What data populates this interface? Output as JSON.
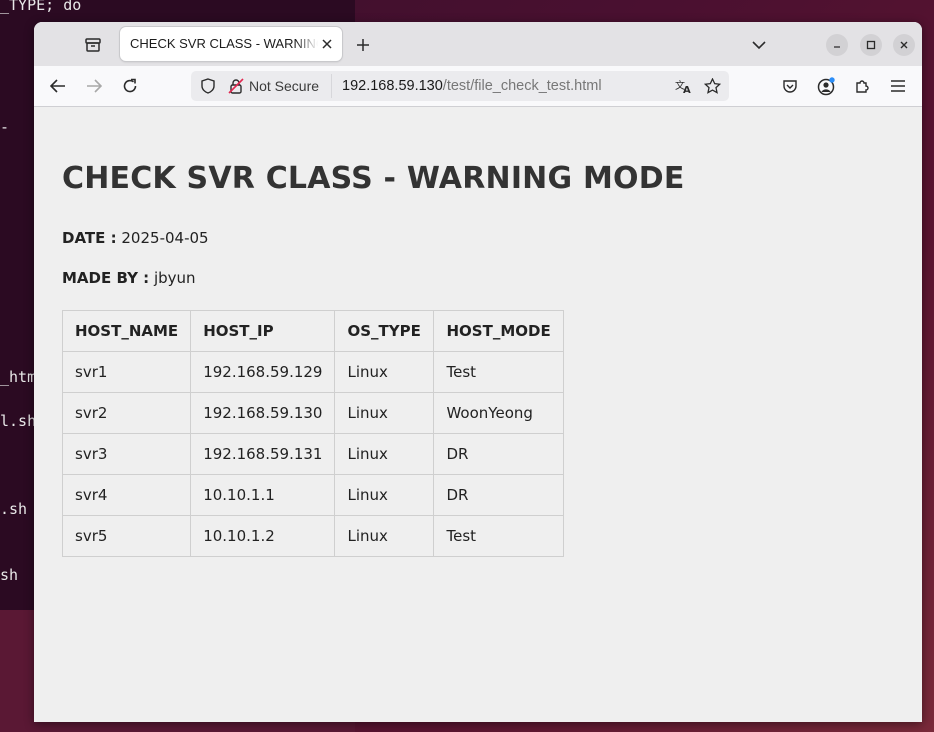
{
  "terminal": {
    "lines": [
      "_TYPE; do",
      "",
      "_htm",
      "l.sh",
      ".sh",
      "sh"
    ]
  },
  "browser": {
    "tab": {
      "title": "CHECK SVR CLASS - WARNING MODE"
    },
    "security_label": "Not Secure",
    "url": {
      "host": "192.168.59.130",
      "path": "/test/file_check_test.html"
    },
    "icons": {
      "firefox_view": "firefox-view-icon",
      "close": "close-icon",
      "new_tab": "plus-icon",
      "list_tabs": "chevron-down-icon",
      "minimize": "minimize-icon",
      "maximize": "maximize-icon",
      "window_close": "close-icon",
      "back": "back-arrow-icon",
      "forward": "forward-arrow-icon",
      "reload": "reload-icon",
      "tracking": "shield-icon",
      "insecure": "broken-lock-icon",
      "translate": "translate-icon",
      "bookmark": "star-icon",
      "pocket": "pocket-icon",
      "account": "account-icon",
      "extensions": "puzzle-icon",
      "menu": "hamburger-menu-icon"
    },
    "colors": {
      "accent_dot": "#2c8ef8"
    }
  },
  "page": {
    "title": "CHECK SVR CLASS - WARNING MODE",
    "date_label": "DATE :",
    "date_value": "2025-04-05",
    "made_by_label": "MADE BY :",
    "made_by_value": "jbyun",
    "table": {
      "headers": [
        "HOST_NAME",
        "HOST_IP",
        "OS_TYPE",
        "HOST_MODE"
      ],
      "rows": [
        [
          "svr1",
          "192.168.59.129",
          "Linux",
          "Test"
        ],
        [
          "svr2",
          "192.168.59.130",
          "Linux",
          "WoonYeong"
        ],
        [
          "svr3",
          "192.168.59.131",
          "Linux",
          "DR"
        ],
        [
          "svr4",
          "10.10.1.1",
          "Linux",
          "DR"
        ],
        [
          "svr5",
          "10.10.1.2",
          "Linux",
          "Test"
        ]
      ]
    }
  }
}
